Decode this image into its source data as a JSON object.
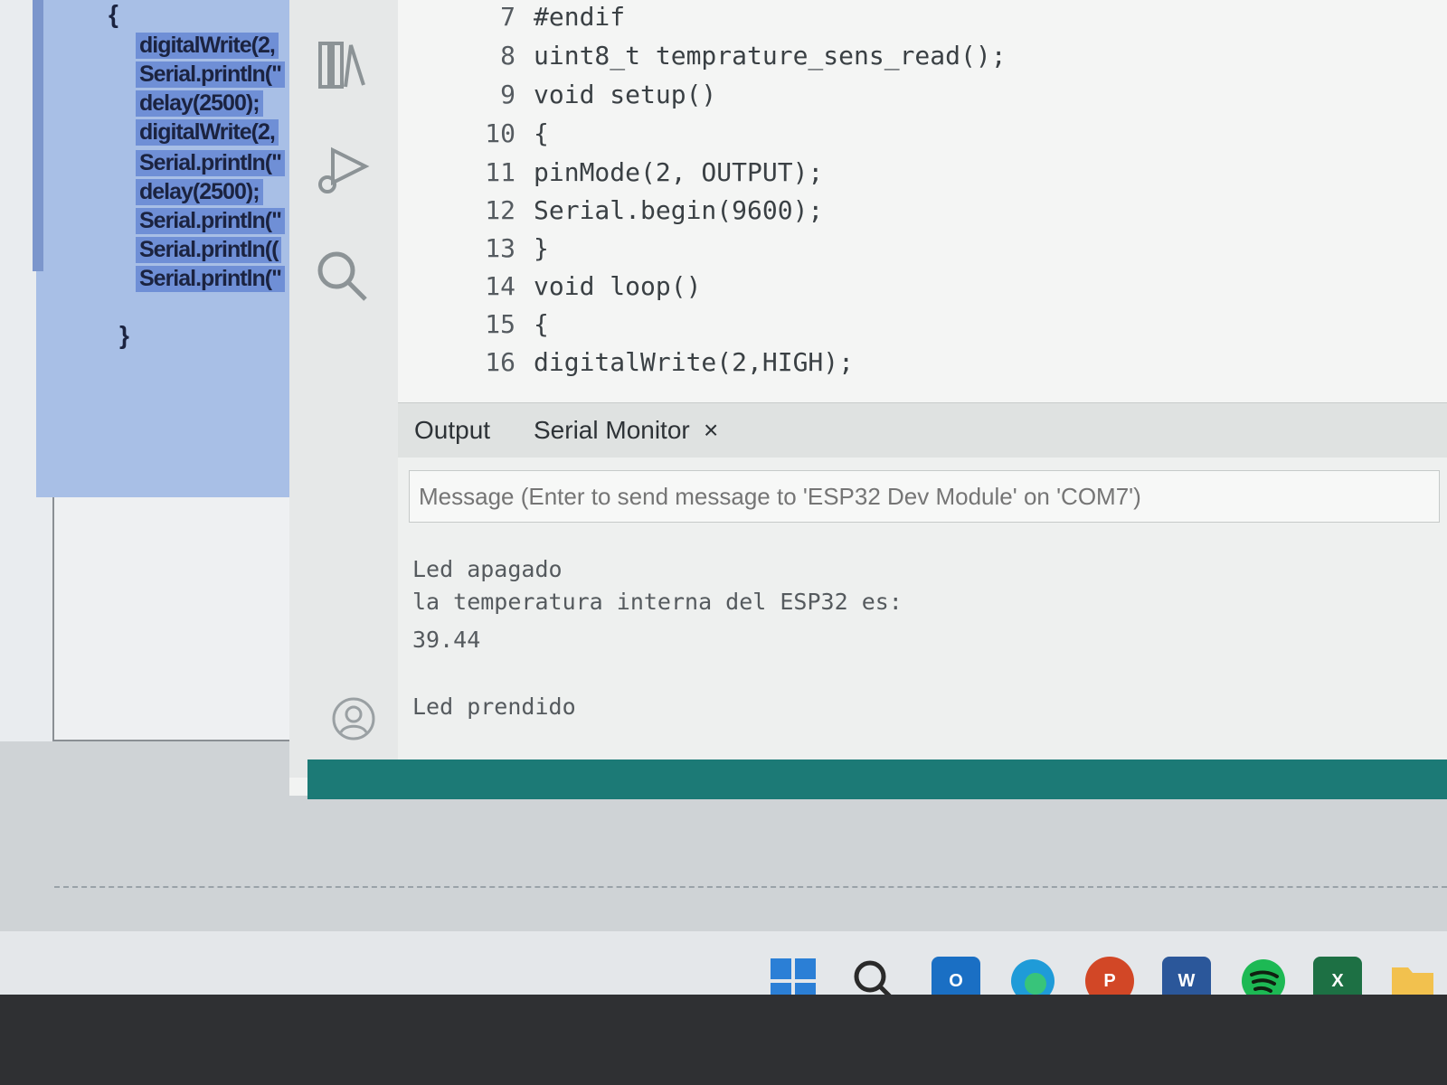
{
  "background_doc": {
    "lines": [
      "digitalWrite(2,",
      "Serial.println(\"",
      "delay(2500);",
      "digitalWrite(2,",
      "Serial.println(\"",
      "delay(2500);",
      "Serial.println(\"",
      "Serial.println((",
      "Serial.println(\""
    ],
    "open_brace": "{",
    "close_brace": "}"
  },
  "editor": {
    "lines": [
      {
        "n": "7",
        "code": "#endif"
      },
      {
        "n": "8",
        "code": "uint8_t temprature_sens_read();"
      },
      {
        "n": "9",
        "code": "void setup()"
      },
      {
        "n": "10",
        "code": "{"
      },
      {
        "n": "11",
        "code": "pinMode(2, OUTPUT);"
      },
      {
        "n": "12",
        "code": "Serial.begin(9600);"
      },
      {
        "n": "13",
        "code": "}"
      },
      {
        "n": "14",
        "code": "void loop()"
      },
      {
        "n": "15",
        "code": "{"
      },
      {
        "n": "16",
        "code": "digitalWrite(2,HIGH);"
      }
    ]
  },
  "panel": {
    "tab_output": "Output",
    "tab_serial": "Serial Monitor",
    "close": "×",
    "message_placeholder": "Message (Enter to send message to 'ESP32 Dev Module' on 'COM7')",
    "output_lines": [
      "Led apagado",
      "la temperatura interna del ESP32 es:",
      "39.44",
      "Led prendido"
    ]
  },
  "taskbar": {
    "icons": [
      "windows-start-icon",
      "search-icon",
      "outlook-icon",
      "edge-icon",
      "powerpoint-icon",
      "word-icon",
      "spotify-icon",
      "excel-icon",
      "file-explorer-icon"
    ],
    "letters": {
      "outlook": "O",
      "powerpoint": "P",
      "word": "W",
      "excel": "X"
    }
  },
  "colors": {
    "accent": "#1c7a76",
    "selection": "#a8bfe6"
  }
}
